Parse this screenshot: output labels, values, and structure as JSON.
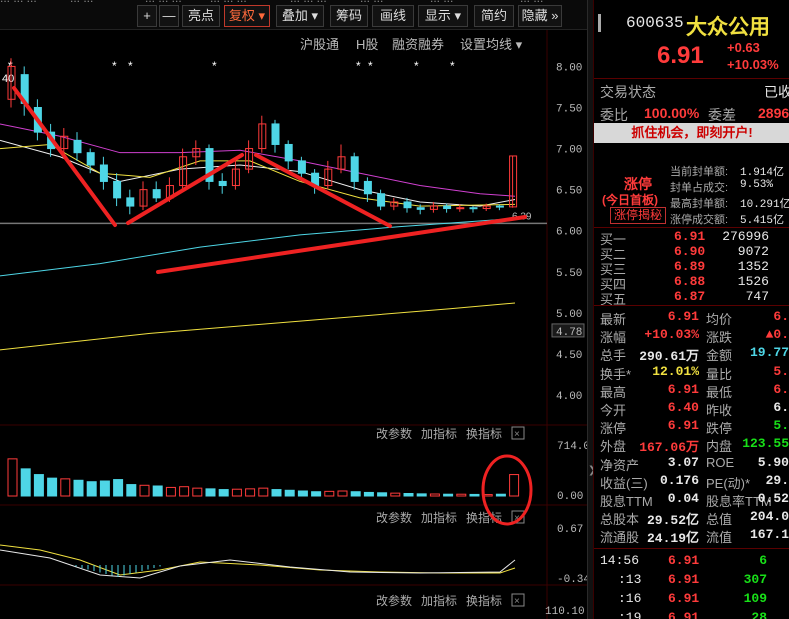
{
  "toolbar": {
    "top_fragments": [
      "... ... ...",
      "... ...",
      "... ... ...",
      "... ... ...",
      "... ... ...",
      "... ...",
      "... ...",
      "... ..."
    ],
    "buttons": [
      {
        "label": "+",
        "name": "zoom-in-button"
      },
      {
        "label": "—",
        "name": "zoom-out-button"
      },
      {
        "label": "亮点",
        "name": "highlight-button"
      },
      {
        "label": "复权 ▾",
        "name": "restore-rights-button"
      },
      {
        "label": "叠加 ▾",
        "name": "overlay-button"
      },
      {
        "label": "筹码",
        "name": "chips-button"
      },
      {
        "label": "画线",
        "name": "draw-line-button"
      },
      {
        "label": "显示 ▾",
        "name": "display-button"
      },
      {
        "label": "简约",
        "name": "simple-button"
      },
      {
        "label": "隐藏 »",
        "name": "hide-button"
      }
    ]
  },
  "chart": {
    "sub_toolbar": [
      "沪股通",
      "H股",
      "融资融券",
      "设置均线 ▾"
    ],
    "top_left_value": "40",
    "price_axis": [
      "8.00",
      "7.50",
      "7.00",
      "6.50",
      "6.00",
      "5.50",
      "5.00",
      "4.78",
      "4.50",
      "4.00"
    ],
    "current_marker": "6.39",
    "volume_axis": [
      "714.00",
      "0.00"
    ],
    "macd_axis": [
      "0.67",
      "-0.34"
    ],
    "third_axis": [
      "110.10"
    ],
    "panel_buttons": [
      "改参数",
      "加指标",
      "换指标"
    ],
    "star_marks": 9
  },
  "chart_data": {
    "type": "candlestick",
    "ylim": [
      4.0,
      8.2
    ],
    "candles": [
      [
        7.6,
        8.0,
        7.5,
        8.1
      ],
      [
        7.9,
        7.55,
        7.4,
        8.0
      ],
      [
        7.5,
        7.2,
        7.1,
        7.6
      ],
      [
        7.2,
        7.0,
        6.9,
        7.3
      ],
      [
        7.0,
        7.15,
        6.9,
        7.25
      ],
      [
        7.1,
        6.95,
        6.85,
        7.2
      ],
      [
        6.95,
        6.8,
        6.7,
        7.0
      ],
      [
        6.8,
        6.6,
        6.5,
        6.9
      ],
      [
        6.6,
        6.4,
        6.3,
        6.7
      ],
      [
        6.4,
        6.3,
        6.2,
        6.5
      ],
      [
        6.3,
        6.5,
        6.25,
        6.6
      ],
      [
        6.5,
        6.4,
        6.35,
        6.6
      ],
      [
        6.4,
        6.55,
        6.35,
        6.65
      ],
      [
        6.55,
        6.9,
        6.5,
        7.0
      ],
      [
        6.9,
        7.0,
        6.8,
        7.1
      ],
      [
        7.0,
        6.6,
        6.5,
        7.05
      ],
      [
        6.6,
        6.55,
        6.45,
        6.7
      ],
      [
        6.55,
        6.75,
        6.5,
        6.85
      ],
      [
        6.75,
        7.0,
        6.7,
        7.1
      ],
      [
        7.0,
        7.3,
        6.95,
        7.4
      ],
      [
        7.3,
        7.05,
        6.95,
        7.35
      ],
      [
        7.05,
        6.85,
        6.75,
        7.1
      ],
      [
        6.85,
        6.7,
        6.6,
        6.9
      ],
      [
        6.7,
        6.55,
        6.45,
        6.75
      ],
      [
        6.55,
        6.75,
        6.5,
        6.85
      ],
      [
        6.75,
        6.9,
        6.7,
        7.05
      ],
      [
        6.9,
        6.6,
        6.5,
        6.95
      ],
      [
        6.6,
        6.45,
        6.35,
        6.65
      ],
      [
        6.45,
        6.3,
        6.25,
        6.5
      ],
      [
        6.3,
        6.35,
        6.25,
        6.4
      ],
      [
        6.35,
        6.28,
        6.22,
        6.4
      ],
      [
        6.28,
        6.26,
        6.2,
        6.32
      ],
      [
        6.26,
        6.3,
        6.22,
        6.35
      ],
      [
        6.3,
        6.27,
        6.22,
        6.33
      ],
      [
        6.27,
        6.28,
        6.23,
        6.32
      ],
      [
        6.28,
        6.27,
        6.22,
        6.3
      ],
      [
        6.27,
        6.3,
        6.24,
        6.33
      ],
      [
        6.3,
        6.29,
        6.25,
        6.32
      ],
      [
        6.29,
        6.91,
        6.28,
        6.91
      ]
    ],
    "volume": [
      520,
      380,
      300,
      250,
      240,
      220,
      200,
      210,
      230,
      160,
      150,
      140,
      120,
      130,
      110,
      100,
      90,
      95,
      100,
      110,
      90,
      80,
      70,
      60,
      65,
      70,
      60,
      50,
      45,
      40,
      35,
      30,
      28,
      25,
      25,
      22,
      20,
      25,
      300
    ]
  },
  "quote": {
    "code": "600635",
    "name": "大众公用",
    "price": "6.91",
    "change": "+0.63",
    "change_pct": "+10.03%",
    "status_label": "交易状态",
    "status_value": "已收",
    "ratio_label": "委比",
    "ratio_value": "100.00%",
    "diff_label": "委差",
    "diff_value": "2896",
    "promo": "抓住机会，即刻开户!",
    "limit_up_label": "涨停",
    "first_board": "(今日首板)",
    "reveal_button": "涨停揭秘",
    "limit_stats": [
      {
        "label": "当前封单额:",
        "value": "1.914亿"
      },
      {
        "label": "封单占成交:",
        "value": "9.53%"
      },
      {
        "label": "最高封单额:",
        "value": "10.291亿"
      },
      {
        "label": "涨停成交额:",
        "value": "5.415亿"
      }
    ],
    "bids": [
      {
        "label": "买一",
        "price": "6.91",
        "vol": "276996"
      },
      {
        "label": "买二",
        "price": "6.90",
        "vol": "9072"
      },
      {
        "label": "买三",
        "price": "6.89",
        "vol": "1352"
      },
      {
        "label": "买四",
        "price": "6.88",
        "vol": "1526"
      },
      {
        "label": "买五",
        "price": "6.87",
        "vol": "747"
      }
    ],
    "stats_left": [
      {
        "label": "最新",
        "value": "6.91"
      },
      {
        "label": "涨幅",
        "value": "+10.03%"
      },
      {
        "label": "总手",
        "value": "290.61万"
      },
      {
        "label": "换手*",
        "value": "12.01%"
      },
      {
        "label": "最高",
        "value": "6.91"
      },
      {
        "label": "今开",
        "value": "6.40"
      },
      {
        "label": "涨停",
        "value": "6.91"
      },
      {
        "label": "外盘",
        "value": "167.06万"
      },
      {
        "label": "净资产",
        "value": "3.07"
      },
      {
        "label": "收益(三)",
        "value": "0.176"
      },
      {
        "label": "股息TTM",
        "value": "0.04"
      },
      {
        "label": "总股本",
        "value": "29.52亿"
      },
      {
        "label": "流通股",
        "value": "24.19亿"
      }
    ],
    "stats_right": [
      {
        "label": "均价",
        "value": "6."
      },
      {
        "label": "涨跌",
        "value": "▲0."
      },
      {
        "label": "金额",
        "value": "19.77"
      },
      {
        "label": "量比",
        "value": "5."
      },
      {
        "label": "最低",
        "value": "6."
      },
      {
        "label": "昨收",
        "value": "6."
      },
      {
        "label": "跌停",
        "value": "5."
      },
      {
        "label": "内盘",
        "value": "123.55"
      },
      {
        "label": "ROE",
        "value": "5.90"
      },
      {
        "label": "PE(动)*",
        "value": "29."
      },
      {
        "label": "股息率TTM",
        "value": "0.52"
      },
      {
        "label": "总值",
        "value": "204.0"
      },
      {
        "label": "流值",
        "value": "167.1"
      }
    ],
    "ticks": [
      {
        "time": "14:56",
        "price": "6.91",
        "vol": "6"
      },
      {
        "time": ":13",
        "price": "6.91",
        "vol": "307"
      },
      {
        "time": ":16",
        "price": "6.91",
        "vol": "109"
      },
      {
        "time": ":19",
        "price": "6.91",
        "vol": "28"
      }
    ]
  }
}
